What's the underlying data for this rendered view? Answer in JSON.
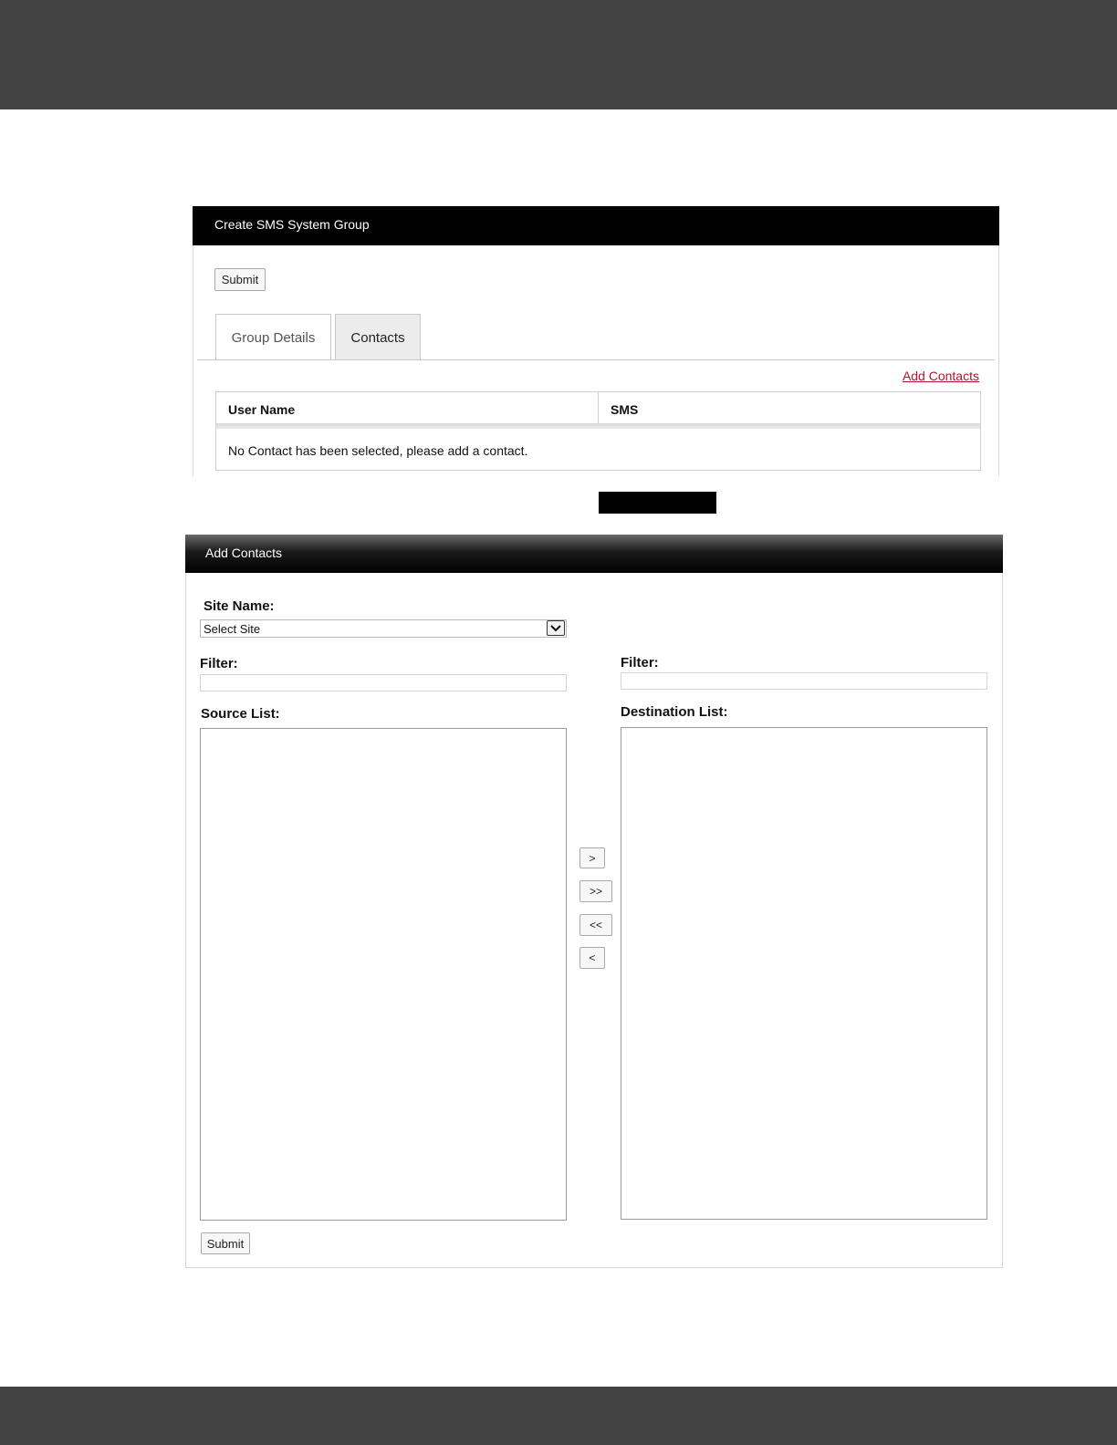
{
  "create_panel": {
    "title": "Create SMS System Group",
    "submit_label": "Submit",
    "tabs": [
      {
        "label": "Group Details",
        "active": false
      },
      {
        "label": "Contacts",
        "active": true
      }
    ],
    "add_contacts_link": "Add Contacts",
    "table": {
      "columns": [
        "User Name",
        "SMS"
      ],
      "empty_message": "No Contact has been selected, please add a contact."
    }
  },
  "add_panel": {
    "title": "Add Contacts",
    "site_name_label": "Site Name:",
    "site_select_value": "Select Site",
    "source_filter_label": "Filter:",
    "destination_filter_label": "Filter:",
    "source_list_label": "Source List:",
    "destination_list_label": "Destination List:",
    "move_buttons": [
      ">",
      ">>",
      "<<",
      "<"
    ],
    "submit_label": "Submit"
  },
  "colors": {
    "frame_band": "#424242",
    "header_bg": "#000000",
    "link": "#b0132c"
  },
  "icons": {
    "select_arrow": "chevron-down-icon"
  }
}
